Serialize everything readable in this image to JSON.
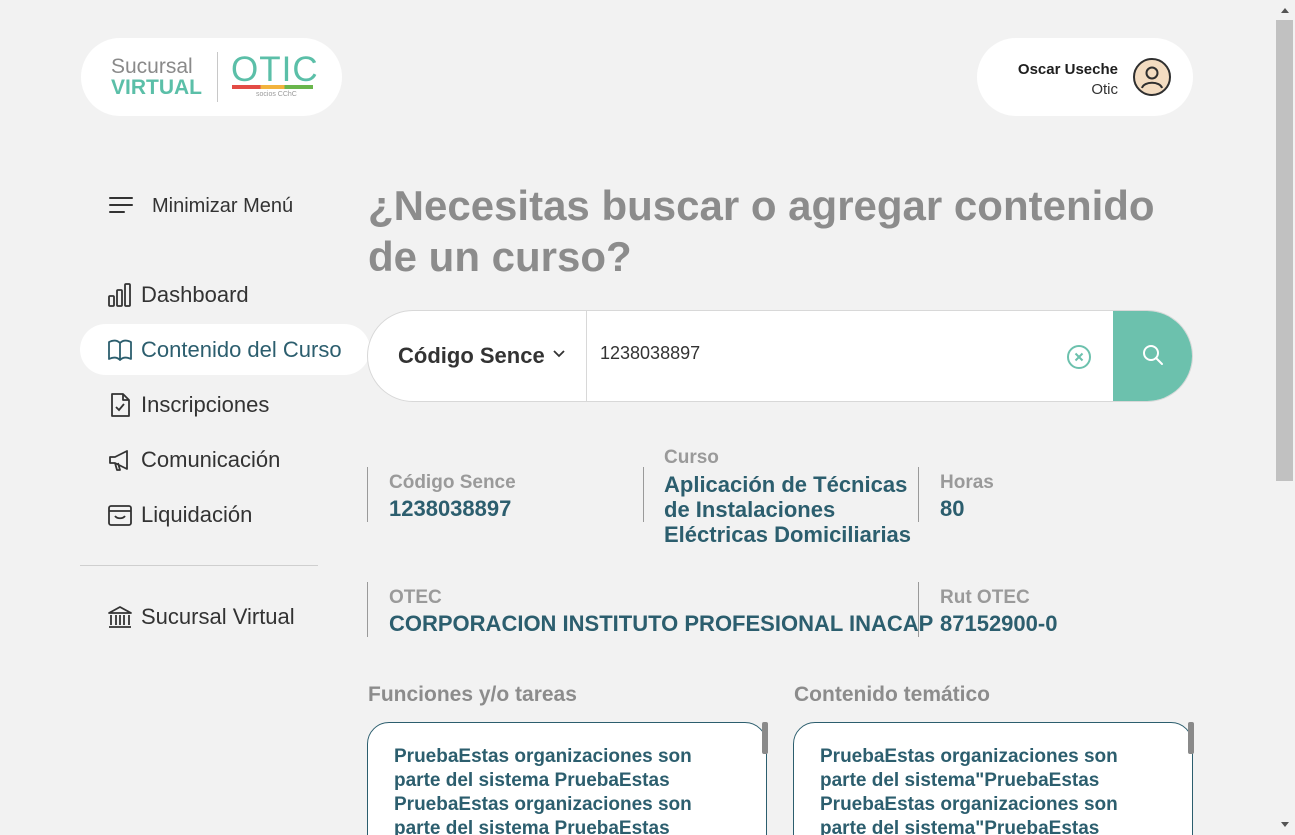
{
  "header": {
    "logo": {
      "line1": "Sucursal",
      "line2": "VIRTUAL",
      "brand": "OTIC",
      "brand_sub": "socios CChC"
    },
    "user": {
      "name": "Oscar Useche",
      "role": "Otic",
      "avatar_icon": "user-avatar-icon"
    }
  },
  "sidebar": {
    "minimize_label": "Minimizar Menú",
    "items": [
      {
        "label": "Dashboard",
        "icon": "bar-chart-icon"
      },
      {
        "label": "Contenido del Curso",
        "icon": "book-icon",
        "active": true
      },
      {
        "label": "Inscripciones",
        "icon": "document-check-icon"
      },
      {
        "label": "Comunicación",
        "icon": "megaphone-icon"
      },
      {
        "label": "Liquidación",
        "icon": "wallet-icon"
      }
    ],
    "footer_item": {
      "label": "Sucursal Virtual",
      "icon": "bank-icon"
    }
  },
  "main": {
    "title": "¿Necesitas buscar o agregar contenido de un curso?",
    "search": {
      "type_label": "Código Sence",
      "value": "1238038897"
    },
    "fields": {
      "codigo_label": "Código Sence",
      "codigo_value": "1238038897",
      "curso_label": "Curso",
      "curso_line1": "Aplicación de Técnicas",
      "curso_line2": "de Instalaciones",
      "curso_line3": "Eléctricas Domiciliarias",
      "horas_label": "Horas",
      "horas_value": "80",
      "otec_label": "OTEC",
      "otec_value": "CORPORACION INSTITUTO PROFESIONAL INACAP",
      "rut_label": "Rut OTEC",
      "rut_value": "87152900-0"
    },
    "funciones": {
      "title": "Funciones y/o tareas",
      "text": "PruebaEstas organizaciones son parte del sistema PruebaEstas PruebaEstas organizaciones son parte del sistema PruebaEstas"
    },
    "contenido": {
      "title": "Contenido temático",
      "text": "PruebaEstas organizaciones son parte del sistema\"PruebaEstas PruebaEstas organizaciones son parte del sistema\"PruebaEstas"
    }
  },
  "colors": {
    "accent": "#6cc1ad",
    "value_text": "#2c5e6e",
    "muted": "#8c8c8c"
  }
}
